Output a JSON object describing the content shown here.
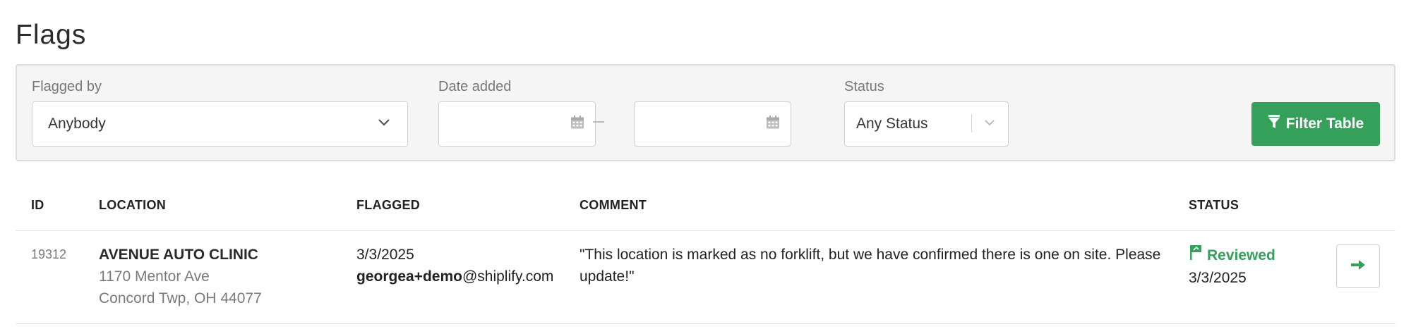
{
  "page": {
    "title": "Flags"
  },
  "filters": {
    "flagged_by": {
      "label": "Flagged by",
      "value": "Anybody"
    },
    "date_added": {
      "label": "Date added",
      "from_value": "",
      "to_value": ""
    },
    "status": {
      "label": "Status",
      "value": "Any Status"
    },
    "filter_button": {
      "label": "Filter Table"
    }
  },
  "table": {
    "columns": [
      "ID",
      "LOCATION",
      "FLAGGED",
      "COMMENT",
      "STATUS"
    ],
    "rows": [
      {
        "id": "19312",
        "location_name": "AVENUE AUTO CLINIC",
        "address_line1": "1170 Mentor Ave",
        "address_line2": "Concord Twp, OH 44077",
        "flagged_date": "3/3/2025",
        "flagged_by_user": "georgea+demo",
        "flagged_by_domain": "@shiplify.com",
        "comment": "\"This location is marked as no forklift, but we have confirmed there is one on site. Please update!\"",
        "status": "Reviewed",
        "status_date": "3/3/2025"
      }
    ]
  },
  "colors": {
    "accent": "#34a05a",
    "panel_bg": "#f5f5f5",
    "border": "#dcdcdc"
  },
  "icons": [
    "chevron-down-icon",
    "calendar-icon",
    "filter-icon",
    "flag-icon",
    "arrow-right-icon"
  ]
}
